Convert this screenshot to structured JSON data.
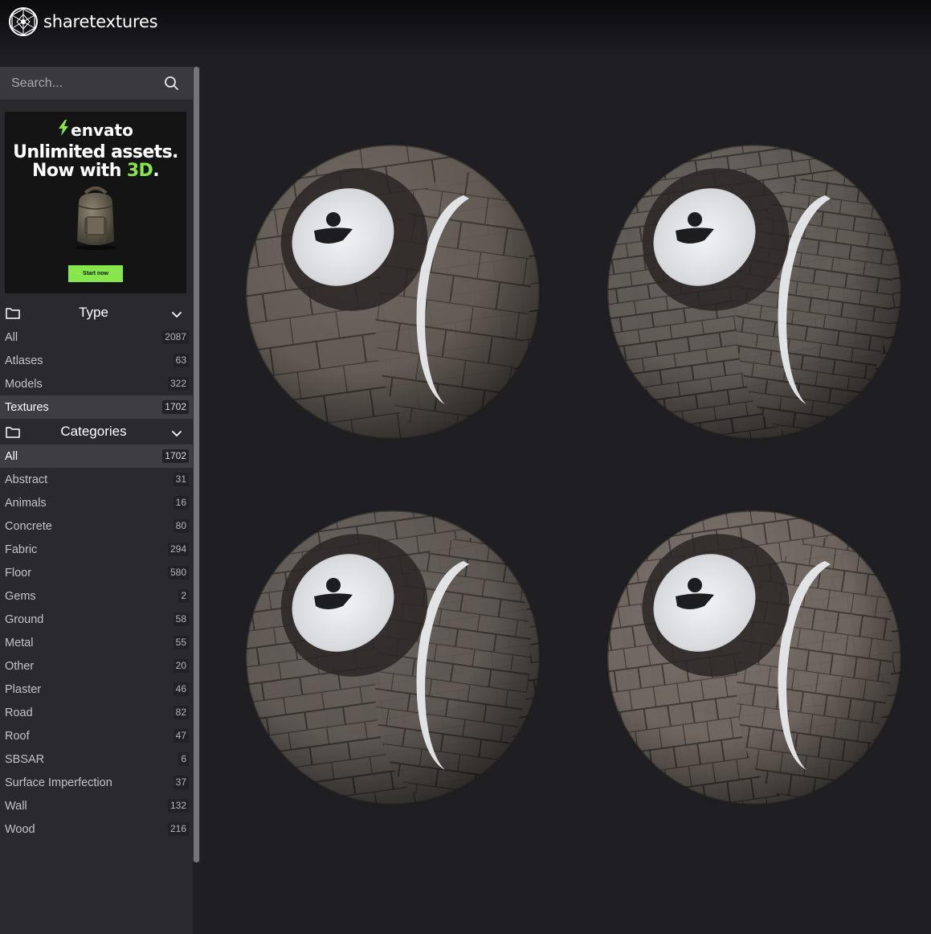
{
  "header": {
    "brand": "sharetextures",
    "logo_icon": "globe-logo-icon"
  },
  "search": {
    "placeholder": "Search...",
    "icon": "search-icon"
  },
  "ad": {
    "brand": "envato",
    "headline_line1": "Unlimited assets.",
    "headline_line2_prefix": "Now with ",
    "headline_line2_accent": "3D",
    "headline_line2_suffix": ".",
    "button_label": "Start now",
    "accent_color": "#87e64b"
  },
  "type_section": {
    "title": "Type",
    "items": [
      {
        "label": "All",
        "count": "2087",
        "active": false
      },
      {
        "label": "Atlases",
        "count": "63",
        "active": false
      },
      {
        "label": "Models",
        "count": "322",
        "active": false
      },
      {
        "label": "Textures",
        "count": "1702",
        "active": true
      }
    ]
  },
  "categories_section": {
    "title": "Categories",
    "items": [
      {
        "label": "All",
        "count": "1702",
        "active": true
      },
      {
        "label": "Abstract",
        "count": "31",
        "active": false
      },
      {
        "label": "Animals",
        "count": "16",
        "active": false
      },
      {
        "label": "Concrete",
        "count": "80",
        "active": false
      },
      {
        "label": "Fabric",
        "count": "294",
        "active": false
      },
      {
        "label": "Floor",
        "count": "580",
        "active": false
      },
      {
        "label": "Gems",
        "count": "2",
        "active": false
      },
      {
        "label": "Ground",
        "count": "58",
        "active": false
      },
      {
        "label": "Metal",
        "count": "55",
        "active": false
      },
      {
        "label": "Other",
        "count": "20",
        "active": false
      },
      {
        "label": "Plaster",
        "count": "46",
        "active": false
      },
      {
        "label": "Road",
        "count": "82",
        "active": false
      },
      {
        "label": "Roof",
        "count": "47",
        "active": false
      },
      {
        "label": "SBSAR",
        "count": "6",
        "active": false
      },
      {
        "label": "Surface Imperfection",
        "count": "37",
        "active": false
      },
      {
        "label": "Wall",
        "count": "132",
        "active": false
      },
      {
        "label": "Wood",
        "count": "216",
        "active": false
      }
    ]
  },
  "textures": [
    {
      "style": "large-blocks"
    },
    {
      "style": "small-bricks"
    },
    {
      "style": "medium-bricks"
    },
    {
      "style": "irregular-stones"
    }
  ]
}
